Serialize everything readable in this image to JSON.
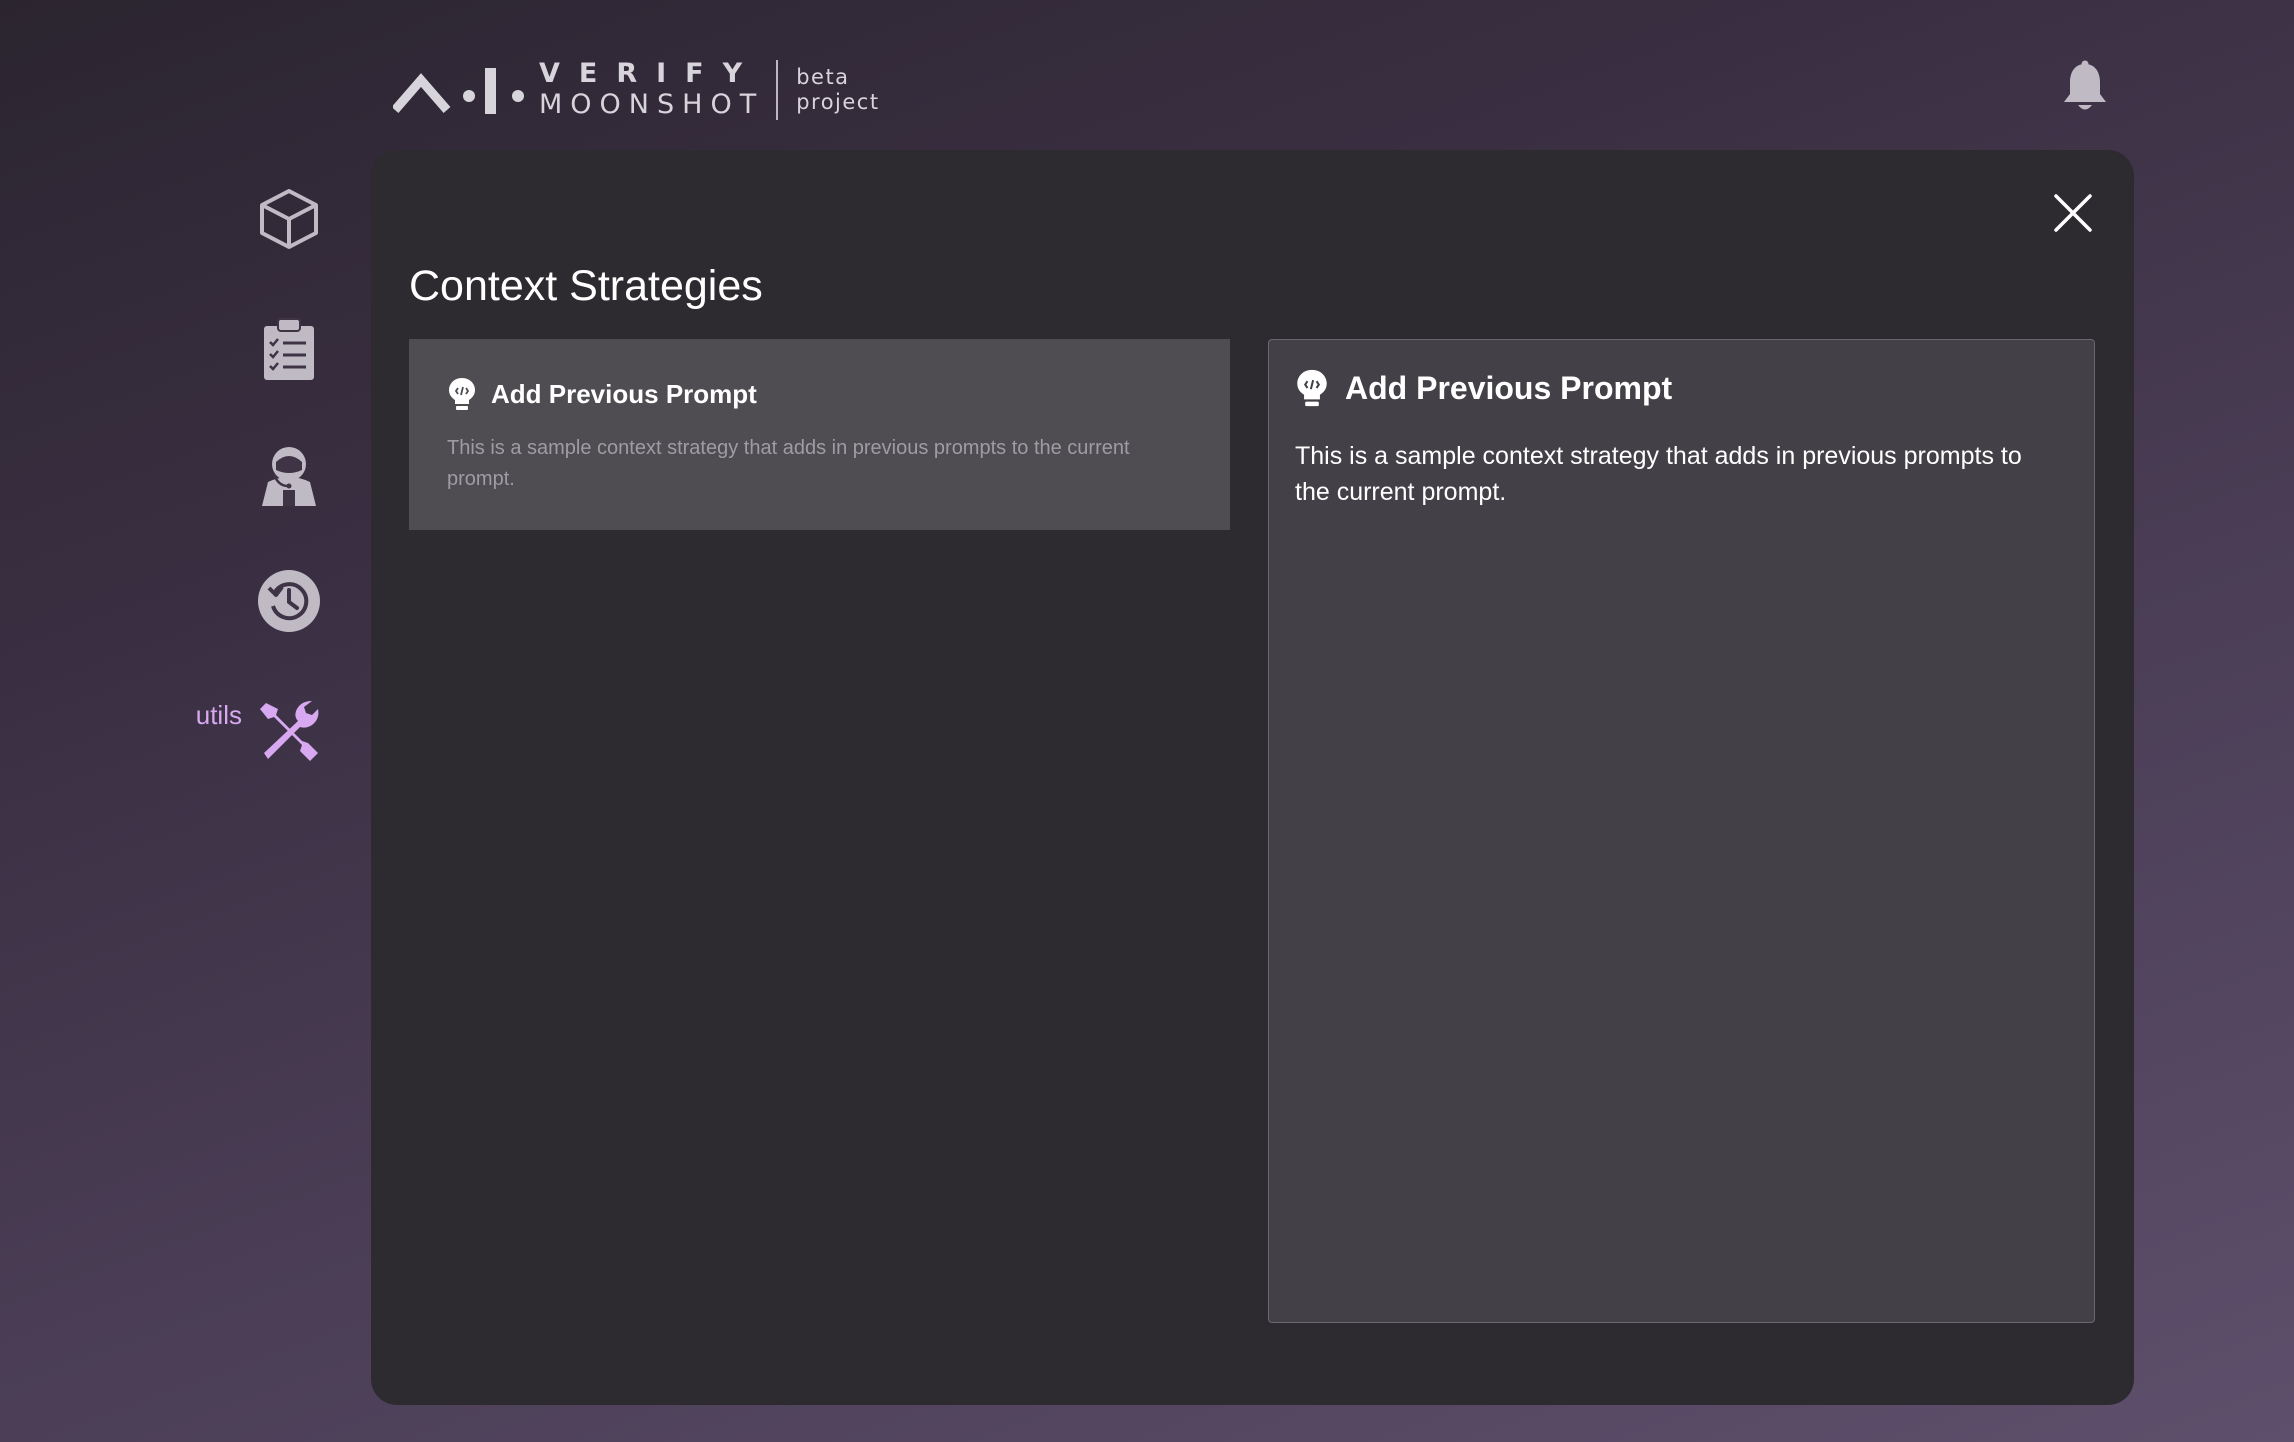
{
  "header": {
    "logo_line1": "VERIFY",
    "logo_line2": "MOONSHOT",
    "tag_line1": "beta",
    "tag_line2": "project"
  },
  "sidebar": {
    "items": [
      {
        "icon": "cube-icon"
      },
      {
        "icon": "clipboard-checklist-icon"
      },
      {
        "icon": "astronaut-icon"
      },
      {
        "icon": "history-icon"
      },
      {
        "icon": "tools-icon",
        "label": "utils",
        "active": true
      }
    ],
    "active_color": "#d8a9f0"
  },
  "modal": {
    "title": "Context Strategies",
    "strategies": [
      {
        "name": "Add Previous Prompt",
        "description": "This is a sample context strategy that adds in previous prompts to the current prompt.",
        "icon": "lightbulb-icon"
      }
    ],
    "detail": {
      "name": "Add Previous Prompt",
      "description": "This is a sample context strategy that adds in previous prompts to the current prompt."
    }
  }
}
